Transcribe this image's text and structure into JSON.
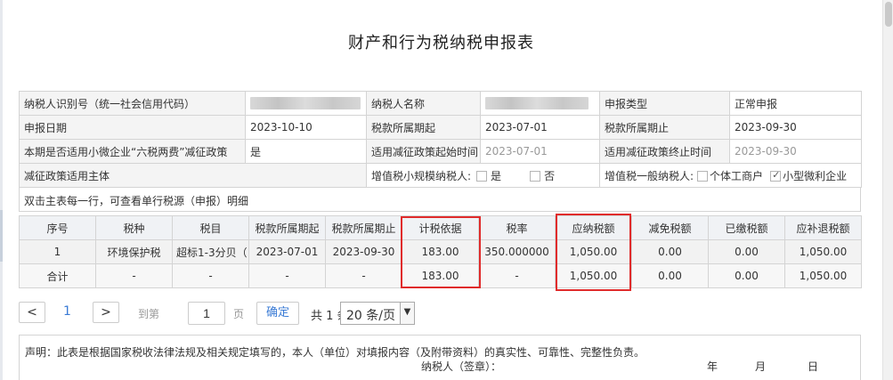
{
  "title": "财产和行为税纳税申报表",
  "info": {
    "taxpayer_id_label": "纳税人识别号（统一社会信用代码）",
    "taxpayer_name_label": "纳税人名称",
    "declare_type_label": "申报类型",
    "declare_type_value": "正常申报",
    "declare_date_label": "申报日期",
    "declare_date_value": "2023-10-10",
    "period_start_label": "税款所属期起",
    "period_start_value": "2023-07-01",
    "period_end_label": "税款所属期止",
    "period_end_value": "2023-09-30",
    "small_micro_label": "本期是否适用小微企业“六税两费”减征政策",
    "small_micro_value": "是",
    "relief_start_label": "适用减征政策起始时间",
    "relief_start_value": "2023-07-01",
    "relief_end_label": "适用减征政策终止时间",
    "relief_end_value": "2023-09-30",
    "relief_subject_label": "减征政策适用主体",
    "vat_small_label": "增值税小规模纳税人:",
    "opt_yes": "是",
    "opt_no": "否",
    "vat_general_label": "增值税一般纳税人:",
    "opt_individual": "个体工商户",
    "opt_small_micro": "小型微利企业",
    "small_micro_checked": true
  },
  "hint": "双击主表每一行，可查看单行税源（申报）明细",
  "grid": {
    "headers": [
      "序号",
      "税种",
      "税目",
      "税款所属期起",
      "税款所属期止",
      "计税依据",
      "税率",
      "应纳税额",
      "减免税额",
      "已缴税额",
      "应补退税额"
    ],
    "rows": [
      [
        "1",
        "环境保护税",
        "超标1-3分贝（",
        "2023-07-01",
        "2023-09-30",
        "183.00",
        "350.000000",
        "1,050.00",
        "0.00",
        "0.00",
        "1,050.00"
      ],
      [
        "合计",
        "-",
        "-",
        "-",
        "-",
        "183.00",
        "-",
        "1,050.00",
        "0.00",
        "0.00",
        "1,050.00"
      ]
    ]
  },
  "pager": {
    "prev": "<",
    "current_page": "1",
    "next": ">",
    "goto_label": "到第",
    "goto_value": "1",
    "page_label": "页",
    "confirm": "确定",
    "total": "共 1 条",
    "page_size": "20 条/页"
  },
  "declaration": {
    "statement": "声明：此表是根据国家税收法律法规及相关规定填写的，本人（单位）对填报内容（及附带资料）的真实性、可靠性、完整性负责。",
    "signature": "纳税人（签章）：",
    "year": "年",
    "month": "月",
    "day": "日"
  },
  "colors": {
    "highlight": "#e02b2b",
    "link": "#3a7bd5"
  }
}
